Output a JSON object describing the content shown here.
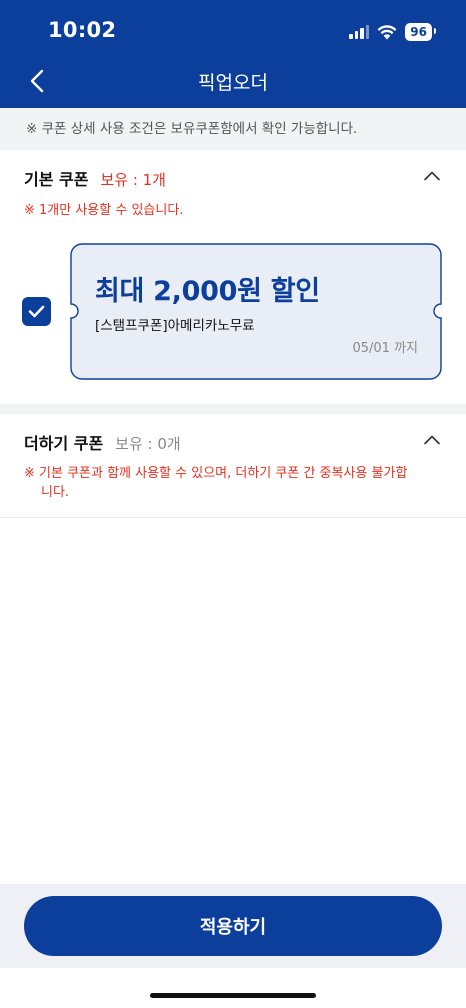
{
  "status": {
    "time": "10:02",
    "battery": "96"
  },
  "nav": {
    "title": "픽업오더"
  },
  "notice": "※ 쿠폰 상세 사용 조건은 보유쿠폰함에서 확인 가능합니다.",
  "basic": {
    "title": "기본 쿠폰",
    "count": "보유 : 1개",
    "warning": "※ 1개만 사용할 수 있습니다.",
    "coupon": {
      "title": "최대 2,000원 할인",
      "name": "[스탬프쿠폰]아메리카노무료",
      "expiry": "05/01 까지",
      "checked": true
    }
  },
  "plus": {
    "title": "더하기 쿠폰",
    "count": "보유 : 0개",
    "warning_line1": "※ 기본 쿠폰과 함께 사용할 수 있으며, 더하기 쿠폰 간 중복사용 불가합",
    "warning_line2": "니다."
  },
  "apply_button": "적용하기",
  "colors": {
    "brand": "#0c3f9c",
    "warning": "#e8311f",
    "coupon_bg": "#e9edf5"
  }
}
